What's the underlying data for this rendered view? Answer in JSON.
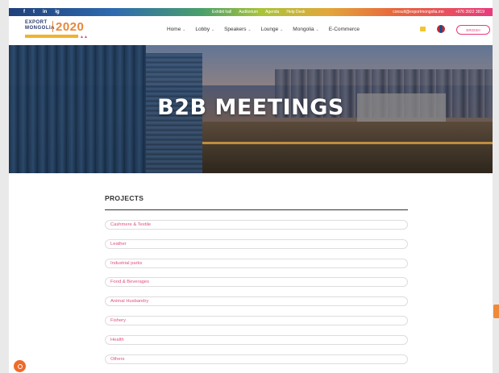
{
  "topbar": {
    "social": [
      "f",
      "t",
      "in",
      "ig"
    ],
    "links": [
      "Exhibit hall",
      "Auditorium",
      "Agenda",
      "Help Desk"
    ],
    "email": "consult@exportmongolia.mn",
    "phone": "+976 3922 3819"
  },
  "logo": {
    "line1": "EXPORT",
    "line2": "MONGOLIA",
    "year": "2020"
  },
  "nav": [
    {
      "label": "Home",
      "chev": "⌄"
    },
    {
      "label": "Lobby",
      "chev": "⌄"
    },
    {
      "label": "Speakers",
      "chev": "⌄"
    },
    {
      "label": "Lounge",
      "chev": "⌄"
    },
    {
      "label": "Mongolia",
      "chev": "⌄"
    },
    {
      "label": "E-Commerce",
      "chev": ""
    }
  ],
  "header": {
    "register_label": "ERGISH"
  },
  "hero": {
    "title": "B2B MEETINGS"
  },
  "projects": {
    "title": "PROJECTS",
    "items": [
      "Cashmere & Textile",
      "Leather",
      "Industrial parks",
      "Food & Beverages",
      "Animal Husbandry",
      "Fishery",
      "Health",
      "Others"
    ]
  },
  "colors": {
    "accent_pink": "#e73b7c",
    "accent_orange": "#f06a2a",
    "text_dark": "#333333"
  }
}
